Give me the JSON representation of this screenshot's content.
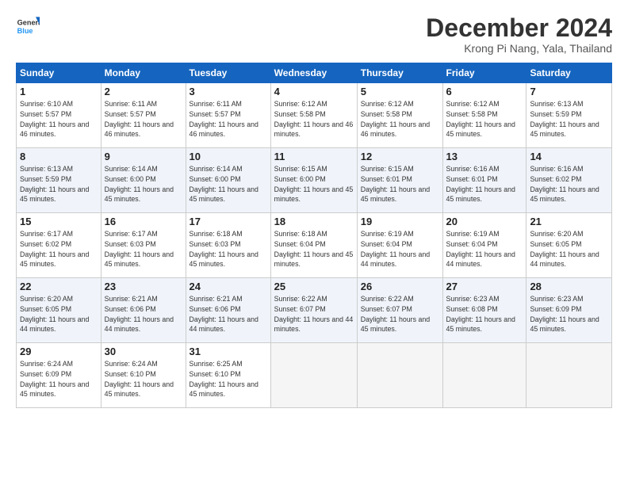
{
  "logo": {
    "line1": "General",
    "line2": "Blue"
  },
  "title": "December 2024",
  "location": "Krong Pi Nang, Yala, Thailand",
  "days_of_week": [
    "Sunday",
    "Monday",
    "Tuesday",
    "Wednesday",
    "Thursday",
    "Friday",
    "Saturday"
  ],
  "weeks": [
    [
      {
        "day": 1,
        "sunrise": "6:10 AM",
        "sunset": "5:57 PM",
        "daylight": "11 hours and 46 minutes."
      },
      {
        "day": 2,
        "sunrise": "6:11 AM",
        "sunset": "5:57 PM",
        "daylight": "11 hours and 46 minutes."
      },
      {
        "day": 3,
        "sunrise": "6:11 AM",
        "sunset": "5:57 PM",
        "daylight": "11 hours and 46 minutes."
      },
      {
        "day": 4,
        "sunrise": "6:12 AM",
        "sunset": "5:58 PM",
        "daylight": "11 hours and 46 minutes."
      },
      {
        "day": 5,
        "sunrise": "6:12 AM",
        "sunset": "5:58 PM",
        "daylight": "11 hours and 46 minutes."
      },
      {
        "day": 6,
        "sunrise": "6:12 AM",
        "sunset": "5:58 PM",
        "daylight": "11 hours and 45 minutes."
      },
      {
        "day": 7,
        "sunrise": "6:13 AM",
        "sunset": "5:59 PM",
        "daylight": "11 hours and 45 minutes."
      }
    ],
    [
      {
        "day": 8,
        "sunrise": "6:13 AM",
        "sunset": "5:59 PM",
        "daylight": "11 hours and 45 minutes."
      },
      {
        "day": 9,
        "sunrise": "6:14 AM",
        "sunset": "6:00 PM",
        "daylight": "11 hours and 45 minutes."
      },
      {
        "day": 10,
        "sunrise": "6:14 AM",
        "sunset": "6:00 PM",
        "daylight": "11 hours and 45 minutes."
      },
      {
        "day": 11,
        "sunrise": "6:15 AM",
        "sunset": "6:00 PM",
        "daylight": "11 hours and 45 minutes."
      },
      {
        "day": 12,
        "sunrise": "6:15 AM",
        "sunset": "6:01 PM",
        "daylight": "11 hours and 45 minutes."
      },
      {
        "day": 13,
        "sunrise": "6:16 AM",
        "sunset": "6:01 PM",
        "daylight": "11 hours and 45 minutes."
      },
      {
        "day": 14,
        "sunrise": "6:16 AM",
        "sunset": "6:02 PM",
        "daylight": "11 hours and 45 minutes."
      }
    ],
    [
      {
        "day": 15,
        "sunrise": "6:17 AM",
        "sunset": "6:02 PM",
        "daylight": "11 hours and 45 minutes."
      },
      {
        "day": 16,
        "sunrise": "6:17 AM",
        "sunset": "6:03 PM",
        "daylight": "11 hours and 45 minutes."
      },
      {
        "day": 17,
        "sunrise": "6:18 AM",
        "sunset": "6:03 PM",
        "daylight": "11 hours and 45 minutes."
      },
      {
        "day": 18,
        "sunrise": "6:18 AM",
        "sunset": "6:04 PM",
        "daylight": "11 hours and 45 minutes."
      },
      {
        "day": 19,
        "sunrise": "6:19 AM",
        "sunset": "6:04 PM",
        "daylight": "11 hours and 44 minutes."
      },
      {
        "day": 20,
        "sunrise": "6:19 AM",
        "sunset": "6:04 PM",
        "daylight": "11 hours and 44 minutes."
      },
      {
        "day": 21,
        "sunrise": "6:20 AM",
        "sunset": "6:05 PM",
        "daylight": "11 hours and 44 minutes."
      }
    ],
    [
      {
        "day": 22,
        "sunrise": "6:20 AM",
        "sunset": "6:05 PM",
        "daylight": "11 hours and 44 minutes."
      },
      {
        "day": 23,
        "sunrise": "6:21 AM",
        "sunset": "6:06 PM",
        "daylight": "11 hours and 44 minutes."
      },
      {
        "day": 24,
        "sunrise": "6:21 AM",
        "sunset": "6:06 PM",
        "daylight": "11 hours and 44 minutes."
      },
      {
        "day": 25,
        "sunrise": "6:22 AM",
        "sunset": "6:07 PM",
        "daylight": "11 hours and 44 minutes."
      },
      {
        "day": 26,
        "sunrise": "6:22 AM",
        "sunset": "6:07 PM",
        "daylight": "11 hours and 45 minutes."
      },
      {
        "day": 27,
        "sunrise": "6:23 AM",
        "sunset": "6:08 PM",
        "daylight": "11 hours and 45 minutes."
      },
      {
        "day": 28,
        "sunrise": "6:23 AM",
        "sunset": "6:09 PM",
        "daylight": "11 hours and 45 minutes."
      }
    ],
    [
      {
        "day": 29,
        "sunrise": "6:24 AM",
        "sunset": "6:09 PM",
        "daylight": "11 hours and 45 minutes."
      },
      {
        "day": 30,
        "sunrise": "6:24 AM",
        "sunset": "6:10 PM",
        "daylight": "11 hours and 45 minutes."
      },
      {
        "day": 31,
        "sunrise": "6:25 AM",
        "sunset": "6:10 PM",
        "daylight": "11 hours and 45 minutes."
      },
      null,
      null,
      null,
      null
    ]
  ]
}
